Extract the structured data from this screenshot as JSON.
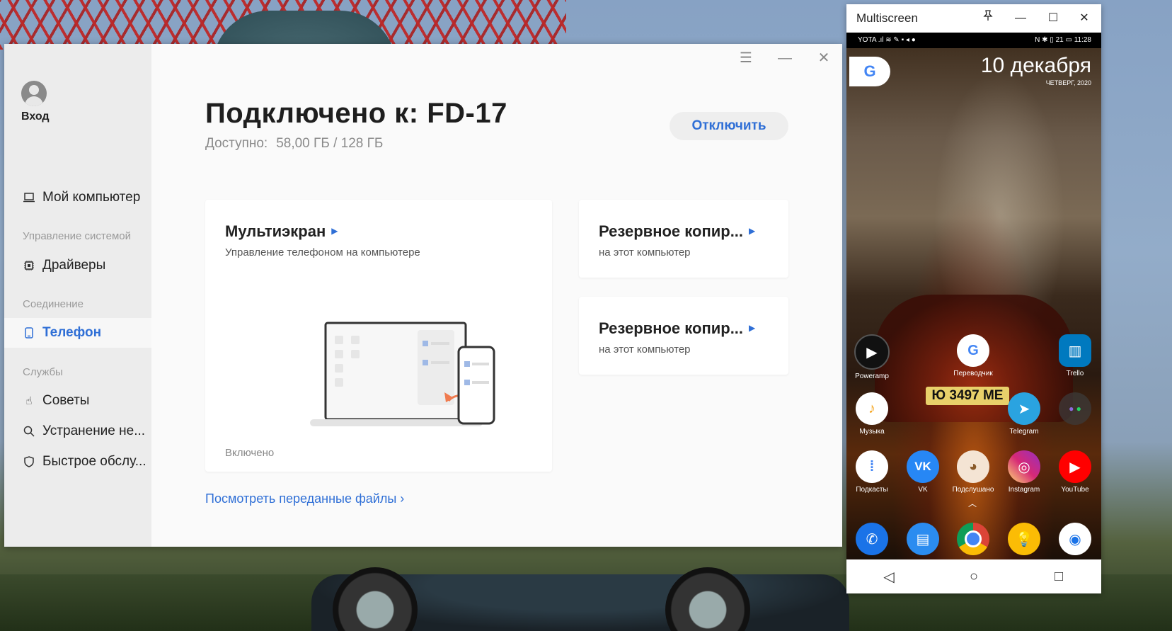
{
  "app": {
    "sidebar": {
      "login": "Вход",
      "my_computer": "Мой компьютер",
      "section_system": "Управление системой",
      "drivers": "Драйверы",
      "section_connection": "Соединение",
      "phone": "Телефон",
      "section_services": "Службы",
      "tips": "Советы",
      "troubleshoot": "Устранение не...",
      "quick_service": "Быстрое обслу..."
    },
    "header": {
      "title": "Подключено к: FD-17",
      "available_label": "Доступно:",
      "available_value": "58,00 ГБ / 128 ГБ",
      "disconnect": "Отключить"
    },
    "cards": {
      "multiscreen": {
        "title": "Мультиэкран",
        "subtitle": "Управление телефоном на компьютере",
        "status": "Включено"
      },
      "backup1": {
        "title": "Резервное копир...",
        "subtitle": "на этот компьютер"
      },
      "backup2": {
        "title": "Резервное копир...",
        "subtitle": "на этот компьютер"
      }
    },
    "files_link": "Посмотреть переданные файлы",
    "window_controls": {
      "menu": "☰",
      "minimize": "—",
      "close": "✕"
    }
  },
  "phone_window": {
    "title": "Multiscreen",
    "status_left": "YOTA .ıl ≋ ✎ ▪ ◂ ●",
    "status_right": "N ✱ ▯ 21 ▭ 11:28",
    "date": "10 декабря",
    "weekday": "ЧЕТВЕРГ, 2020",
    "google": "G",
    "plate": "Ю 3497 МЕ",
    "apps": {
      "poweramp": "Poweramp",
      "translator": "Переводчик",
      "trello": "Trello",
      "music": "Музыка",
      "telegram": "Telegram",
      "podcasts": "Подкасты",
      "vk": "VK",
      "podslushano": "Подслушано",
      "instagram": "Instagram",
      "youtube": "YouTube"
    },
    "colors": {
      "poweramp": "#111111",
      "translator": "#ffffff",
      "trello": "#0079bf",
      "music": "#ffffff",
      "telegram": "#2aa3e0",
      "podcasts": "#ffffff",
      "vk": "#2787f5",
      "podslushano": "#f4e4d4",
      "instagram": "#d6249f",
      "youtube": "#ff0000",
      "phone": "#1a73e8",
      "messages": "#2b8cf0",
      "chrome": "#db4437",
      "tips": "#fbbc05",
      "camera": "#ffffff"
    }
  }
}
